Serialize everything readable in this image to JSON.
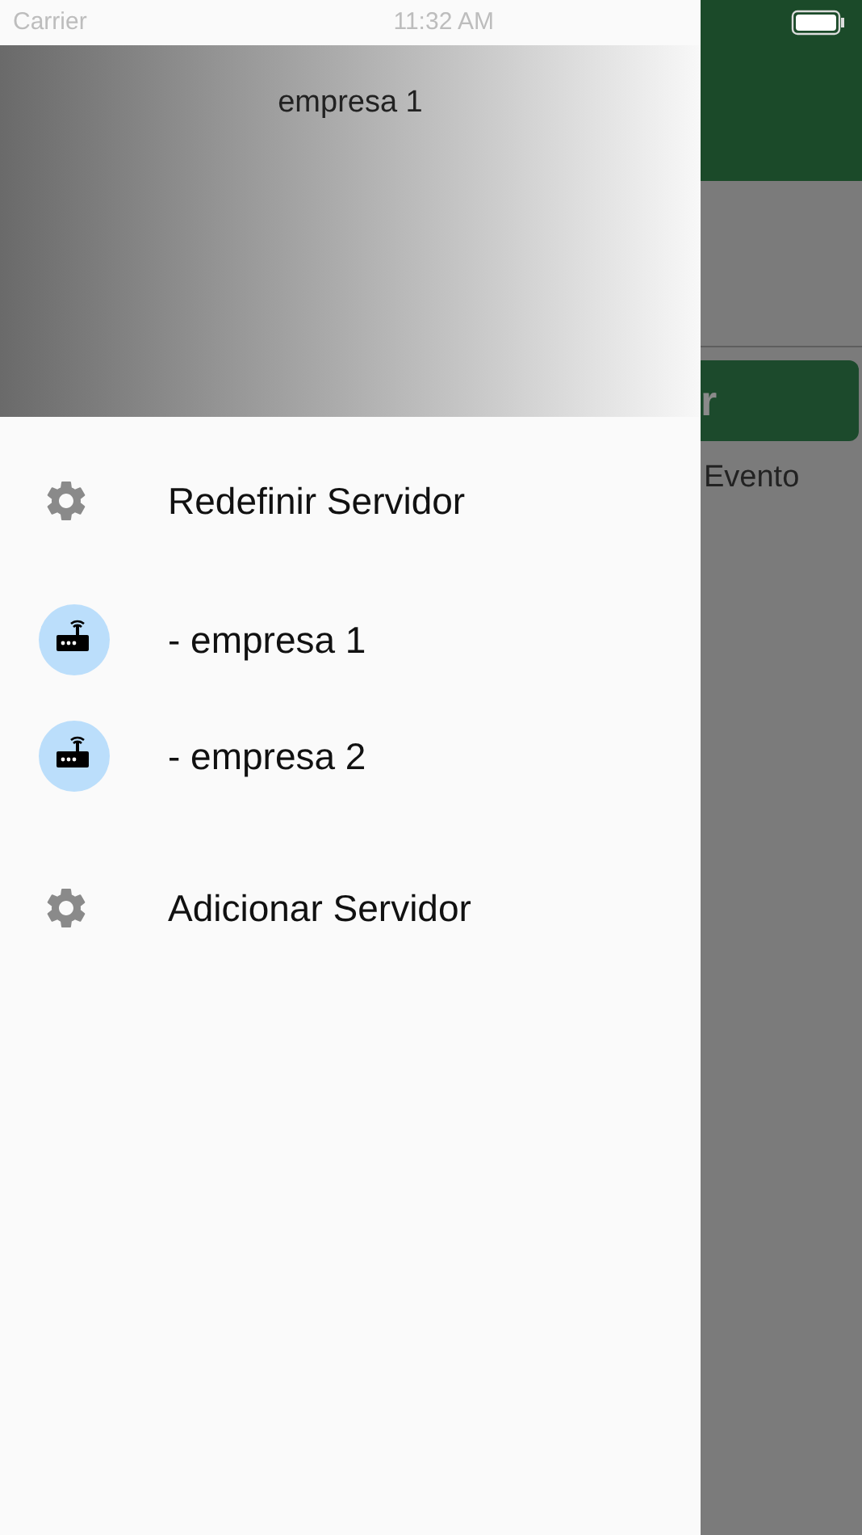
{
  "status_bar": {
    "carrier": "Carrier",
    "time": "11:32 AM"
  },
  "drawer": {
    "header_title": "empresa 1",
    "items": [
      {
        "kind": "settings",
        "label": "Redefinir Servidor"
      },
      {
        "kind": "server",
        "label": "- empresa 1"
      },
      {
        "kind": "server",
        "label": "- empresa 2"
      },
      {
        "kind": "settings",
        "label": "Adicionar Servidor"
      }
    ]
  },
  "background": {
    "button_label": "r",
    "text": "Evento"
  }
}
